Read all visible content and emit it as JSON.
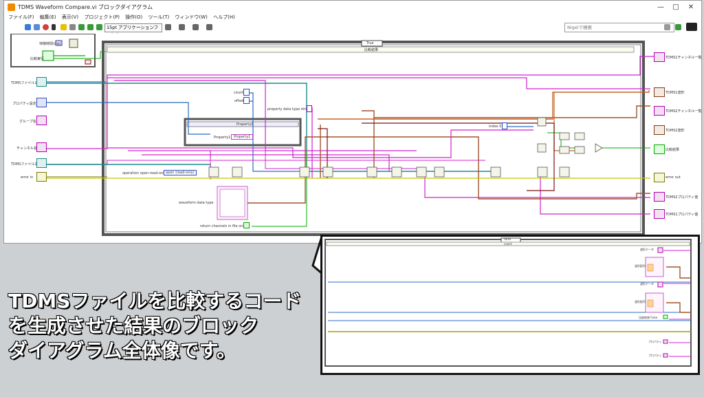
{
  "window": {
    "title": "TDMS Waveform Compare.vi ブロックダイアグラム",
    "controls": {
      "minimize": "—",
      "maximize": "□",
      "close": "✕"
    }
  },
  "menu": [
    "ファイル(F)",
    "編集(E)",
    "表示(V)",
    "プロジェクト(P)",
    "操作(O)",
    "ツール(T)",
    "ウィンドウ(W)",
    "ヘルプ(H)"
  ],
  "toolbar": {
    "font": "15pt アプリケーションフォント",
    "search_placeholder": "Nigelで検索"
  },
  "diagram": {
    "small_box": {
      "wait": "待機時間(ms)",
      "compare": "比較実行"
    },
    "left_controls": [
      "TDMSファイル1",
      "プロパティ設定",
      "グループ名",
      "チャンネル名",
      "TDMSファイル2",
      "error in"
    ],
    "case_selector": "True",
    "loop_label": "比較結果",
    "count_label": "count",
    "offset_label": "offset",
    "prop_type_label": "property data type string",
    "index_label": "index 0",
    "property_box": {
      "title": "Property1",
      "field_label": "Property1",
      "field_value": "Property1"
    },
    "open_label": "operation open-read-only",
    "open_value": "open (read-only)",
    "waveform_label": "waveform data type",
    "return_label": "return channels in file order",
    "right_indicators": [
      "TDMS1チャンネル一覧",
      "TDMS1波形",
      "TDMS2チャンネル一覧",
      "TDMS2波形",
      "比較結果",
      "error out",
      "TDMS2プロパティ値",
      "TDMS1プロパティ値"
    ]
  },
  "zoom": {
    "case_label": "False",
    "loop_label": "count",
    "rows": [
      "波形データ",
      "波形配列",
      "波形データ",
      "波形配列",
      "比較結果 False",
      "プロパティ",
      "プロパティ"
    ]
  },
  "caption": {
    "line1": "TDMSファイルを比較するコード",
    "line2": "を生成させた結果のブロック",
    "line3": "ダイアグラム全体像です。"
  }
}
